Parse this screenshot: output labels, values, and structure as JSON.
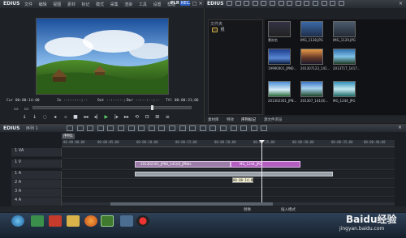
{
  "player": {
    "app_name": "EDIUS",
    "menu": [
      "文件",
      "编辑",
      "视图",
      "素材",
      "标记",
      "模式",
      "采集",
      "渲染",
      "工具",
      "设置",
      "帮助"
    ],
    "mode_label": "PLR",
    "mode_label_2": "REC",
    "tc_cur": "Cur 00:00:14:00",
    "tc_in": "In --:--:--;--",
    "tc_out": "Out --:--:--;--",
    "tc_dur": "Dur --:--:--;--",
    "tc_ttl": "Ttl 00:00:31;06"
  },
  "bin": {
    "app_name": "EDIUS",
    "folder_label": "文件夹",
    "root_label": "根",
    "selected_label": "素材库",
    "tabs": [
      "素材库",
      "特效",
      "序列标记",
      "源文件浏览"
    ],
    "clips": [
      {
        "label": "素材名"
      },
      {
        "label": "IMG_1138.JPG"
      },
      {
        "label": "IMG_1129.JPG"
      },
      {
        "label": "19990001_JPN0..."
      },
      {
        "label": "201307123_141..."
      },
      {
        "label": "2013T1T_1417..."
      },
      {
        "label": "201302301_JPN..."
      },
      {
        "label": "201307_141(0)..."
      },
      {
        "label": "MG_1244_JPG"
      }
    ]
  },
  "timeline": {
    "app_name": "EDIUS",
    "sequence": "序列 1",
    "tab": "序列1",
    "ruler": [
      "00:00:00;00",
      "00:00:05;00",
      "00:00:10;00",
      "00:00:15;00",
      "00:00:20;00",
      "00:00:25;00",
      "00:00:30;00",
      "00:00:35;00",
      "00:00:40;00"
    ],
    "tracks": [
      "1 VA",
      "1 V",
      "1 A",
      "2 A",
      "3 A",
      "4 A"
    ],
    "clip1": "201302301_JPN0_141(0)_JPN4s",
    "clip2": "MG_1244_JPG",
    "tooltip": "00:00:14;00",
    "status_left": "替换",
    "status_right": "插入模式"
  },
  "colors": {
    "clip1": "#9c7ca8",
    "clip2": "#b35ec0",
    "playhead": "#e6e6e6"
  },
  "watermark": {
    "text": "Baidu经验",
    "url": "jingyan.baidu.com"
  }
}
